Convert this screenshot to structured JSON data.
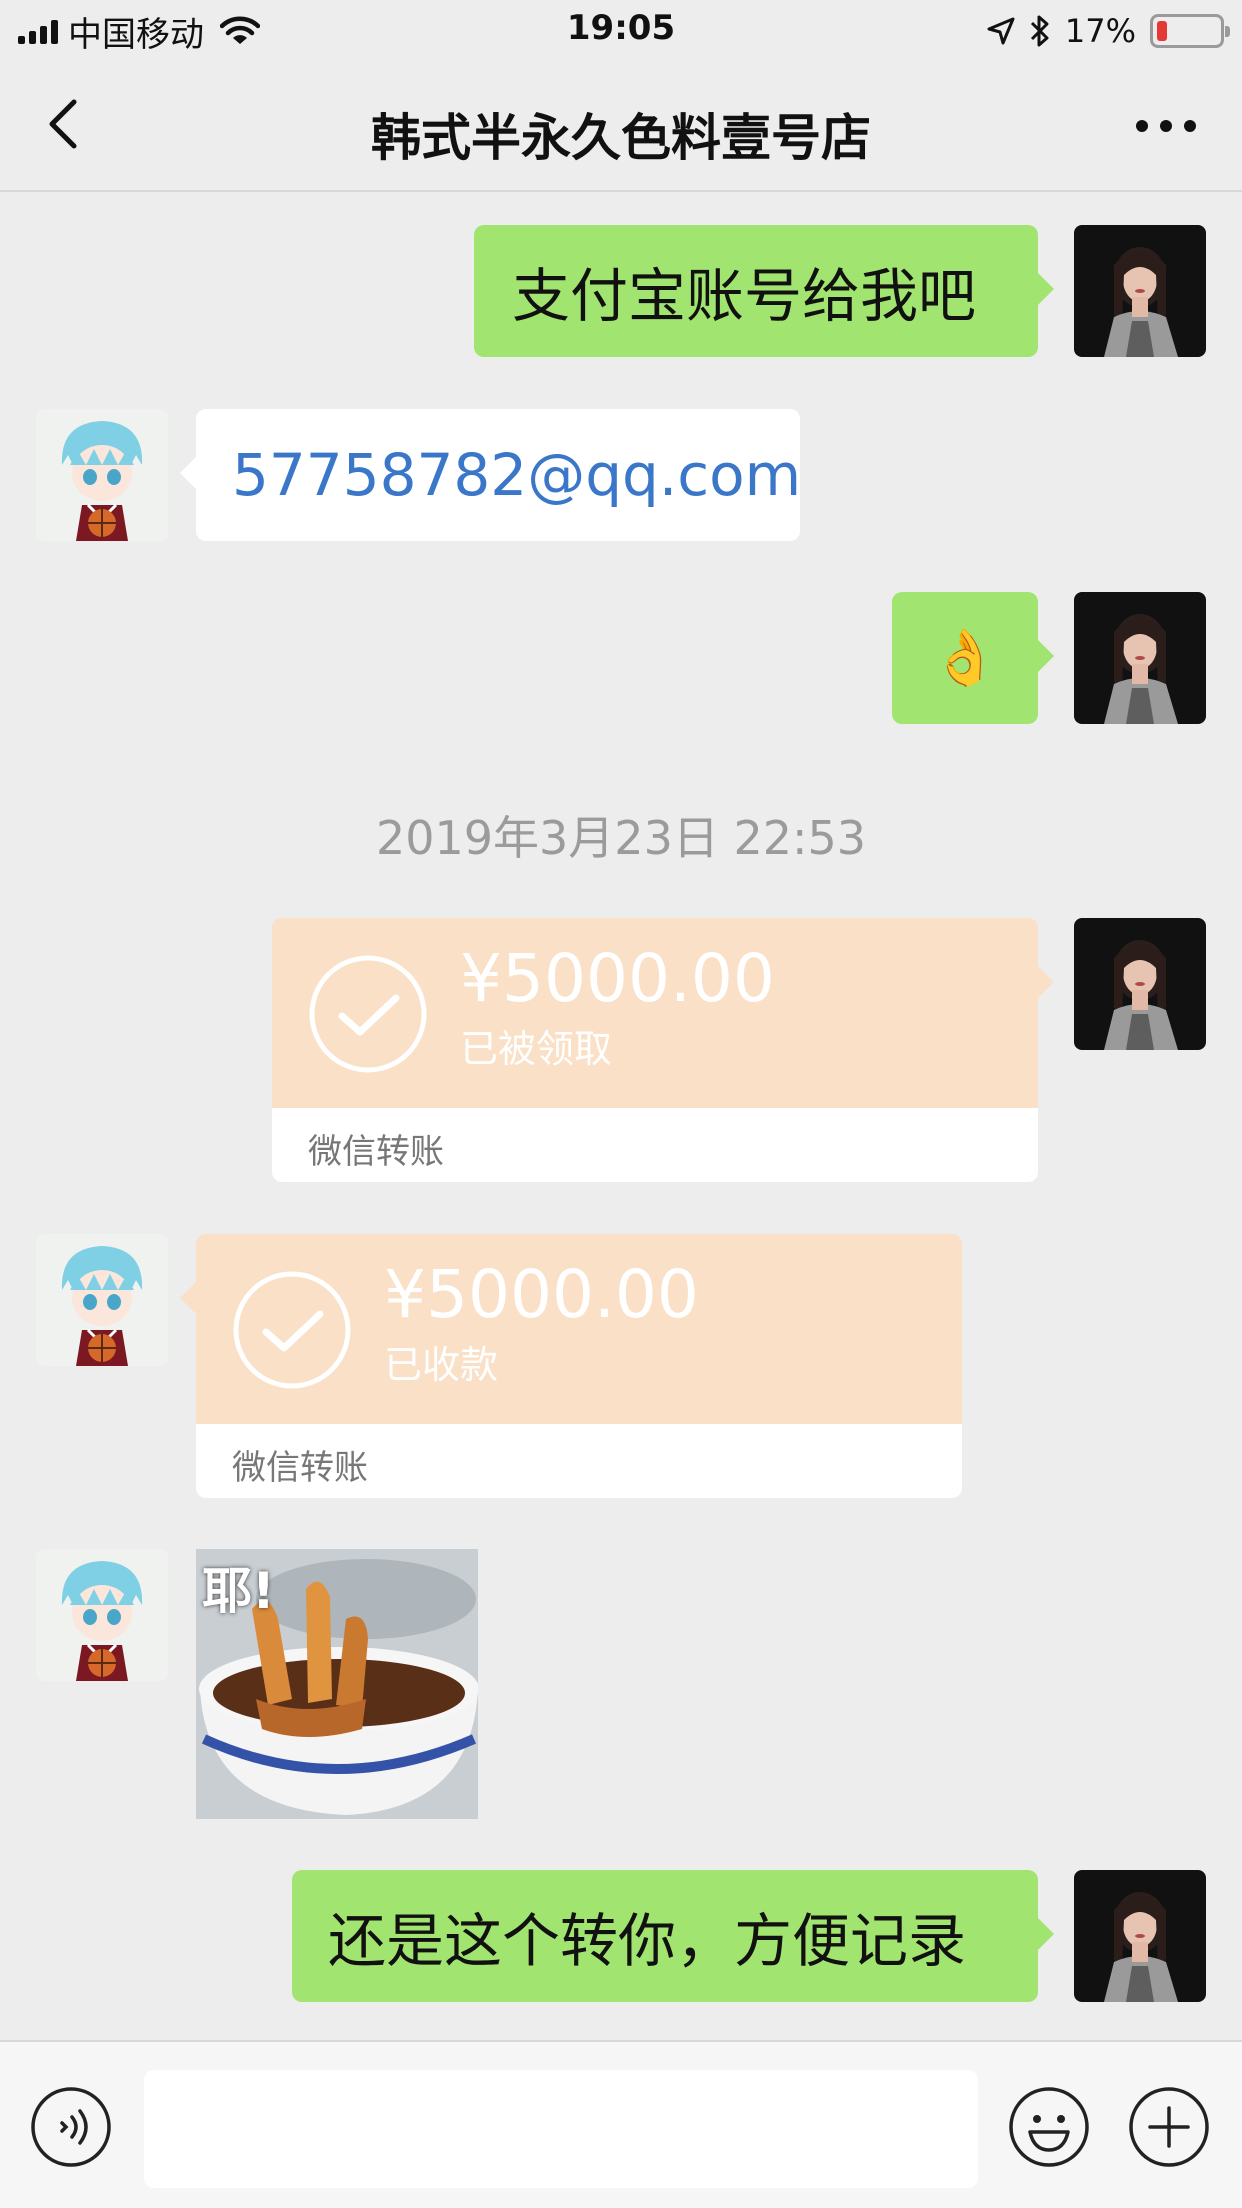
{
  "status_bar": {
    "carrier": "中国移动",
    "time": "19:05",
    "battery": "17%",
    "battery_level": 0.17
  },
  "nav": {
    "title": "韩式半永久色料壹号店"
  },
  "messages": {
    "m1": {
      "text": "支付宝账号给我吧"
    },
    "m2": {
      "text": "57758782@qq.com"
    },
    "m3": {
      "text": "👌"
    },
    "timestamp": "2019年3月23日 22:53",
    "transfer1": {
      "amount": "¥5000.00",
      "status": "已被领取",
      "label": "微信转账"
    },
    "transfer2": {
      "amount": "¥5000.00",
      "status": "已收款",
      "label": "微信转账"
    },
    "sticker": {
      "text": "耶!"
    },
    "m7": {
      "text": "还是这个转你，方便记录"
    }
  },
  "colors": {
    "bubble_green": "#a1e46f",
    "transfer_orange": "#f9e0c7",
    "link_blue": "#3b77c9",
    "background": "#ededed"
  },
  "icons": {
    "back": "chevron-left-icon",
    "more": "more-icon",
    "voice": "voice-icon",
    "emoji": "emoji-icon",
    "plus": "plus-icon",
    "check": "check-circle-icon"
  }
}
